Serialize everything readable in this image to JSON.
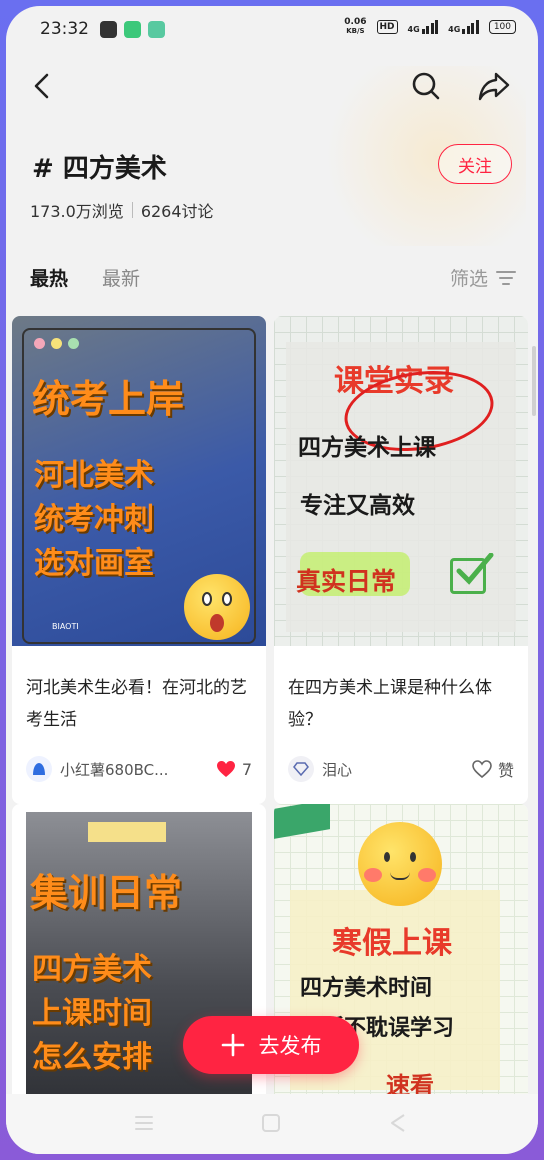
{
  "status_bar": {
    "time": "23:32",
    "net_speed": "0.06",
    "net_unit": "KB/S",
    "hd": "HD",
    "signal1": "4G",
    "signal2": "4G",
    "battery": "100"
  },
  "header": {
    "topic": "# 四方美术",
    "views": "173.0万浏览",
    "discussions": "6264讨论",
    "follow_label": "关注"
  },
  "tabs": {
    "hot": "最热",
    "new": "最新",
    "filter": "筛选"
  },
  "feed": [
    {
      "cover_text": [
        "统考上岸",
        "河北美术",
        "统考冲刺",
        "选对画室"
      ],
      "watermark": "BIAOTI",
      "caption": "河北美术生必看！在河北的艺考生活",
      "author": "小红薯680BC...",
      "likes": "7",
      "liked": true
    },
    {
      "cover_text": [
        "课堂实录",
        "四方美术上课",
        "专注又高效",
        "真实日常"
      ],
      "caption": "在四方美术上课是种什么体验？",
      "author": "泪心",
      "likes": "赞",
      "liked": false
    },
    {
      "cover_text": [
        "集训日常",
        "四方美术",
        "上课时间",
        "怎么安排"
      ]
    },
    {
      "cover_text": [
        "寒假上课",
        "四方美术时间",
        "灵活不耽误学习",
        "速看"
      ]
    }
  ],
  "publish_label": "去发布",
  "colors": {
    "accent": "#ff2442",
    "cover_orange": "#ff8c1a",
    "cover_red": "#e83a2a"
  }
}
